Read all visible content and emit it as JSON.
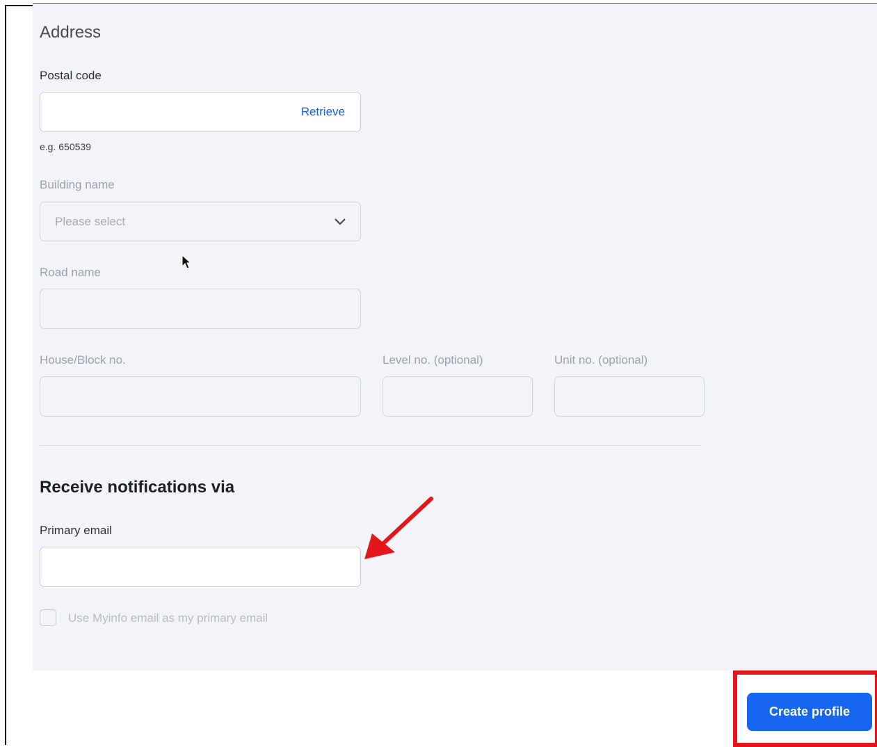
{
  "address": {
    "section_title": "Address",
    "postal_code": {
      "label": "Postal code",
      "value": "",
      "action_label": "Retrieve",
      "hint": "e.g. 650539"
    },
    "building_name": {
      "label": "Building name",
      "selected": "Please select"
    },
    "road_name": {
      "label": "Road name",
      "value": ""
    },
    "house_block": {
      "label": "House/Block no.",
      "value": ""
    },
    "level_no": {
      "label": "Level no. (optional)",
      "value": ""
    },
    "unit_no": {
      "label": "Unit no. (optional)",
      "value": ""
    }
  },
  "notifications": {
    "section_title": "Receive notifications via",
    "primary_email": {
      "label": "Primary email",
      "value": ""
    },
    "use_myinfo": {
      "label": "Use Myinfo email as my primary email",
      "checked": false
    }
  },
  "footer": {
    "create_label": "Create profile"
  },
  "annotations": {
    "highlight_color": "#e3161b",
    "button_color": "#1766f0",
    "link_color": "#1a5fe0"
  }
}
